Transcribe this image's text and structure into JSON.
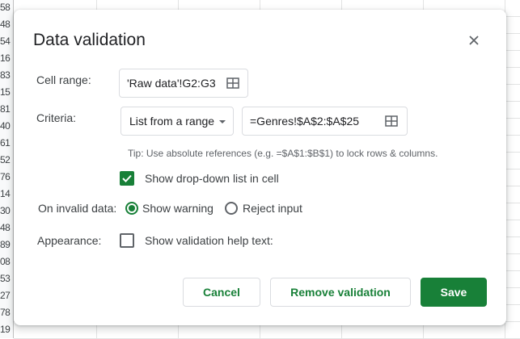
{
  "background": {
    "row_numbers": [
      "58",
      "48",
      "54",
      "16",
      "83",
      "15",
      "81",
      "40",
      "61",
      "52",
      "76",
      "14",
      "30",
      "48",
      "89",
      "08",
      "53",
      "27",
      "78",
      "19"
    ]
  },
  "dialog": {
    "title": "Data validation",
    "close_icon": "close-icon",
    "cell_range": {
      "label": "Cell range:",
      "value": "'Raw data'!G2:G3",
      "icon": "grid-select-icon"
    },
    "criteria": {
      "label": "Criteria:",
      "type_value": "List from a range",
      "range_value": "=Genres!$A$2:$A$25",
      "icon": "grid-select-icon",
      "tip": "Tip: Use absolute references (e.g. =$A$1:$B$1) to lock rows & columns."
    },
    "show_dropdown": {
      "label": "Show drop-down list in cell",
      "checked": true
    },
    "on_invalid": {
      "label": "On invalid data:",
      "options": [
        {
          "label": "Show warning",
          "selected": true
        },
        {
          "label": "Reject input",
          "selected": false
        }
      ]
    },
    "appearance": {
      "label": "Appearance:",
      "checkbox_label": "Show validation help text:",
      "checked": false
    },
    "buttons": {
      "cancel": "Cancel",
      "remove": "Remove validation",
      "save": "Save"
    }
  },
  "colors": {
    "accent": "#188038",
    "text": "#3c4043",
    "border": "#dadce0"
  }
}
